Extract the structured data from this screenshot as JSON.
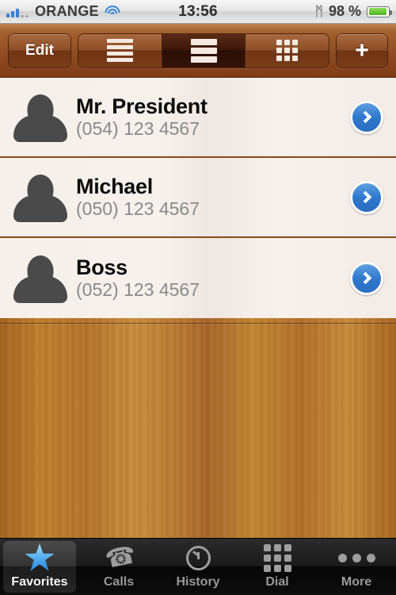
{
  "status_bar": {
    "signal_icon": "signal-bars-icon",
    "signal_bars_filled": 3,
    "signal_bars_total": 5,
    "carrier": "ORANGE",
    "wifi_icon": "wifi-icon",
    "time": "13:56",
    "bluetooth_icon": "bluetooth-icon",
    "bluetooth_glyph": "ᛗ",
    "battery_percent": "98 %",
    "battery_level": 98,
    "battery_icon": "battery-icon",
    "battery_color": "#6ec62e"
  },
  "toolbar": {
    "edit_label": "Edit",
    "add_label": "+",
    "segments": [
      {
        "name": "list-compact-view",
        "icon": "list-lines-icon",
        "selected": false
      },
      {
        "name": "list-large-view",
        "icon": "list-thick-lines-icon",
        "selected": true
      },
      {
        "name": "grid-view",
        "icon": "grid-icon",
        "selected": false
      }
    ],
    "background_color": "#8e4a21"
  },
  "contacts": [
    {
      "name": "Mr. President",
      "phone": "(054) 123 4567",
      "avatar_icon": "person-silhouette-icon",
      "disclosure_icon": "chevron-right-icon"
    },
    {
      "name": "Michael",
      "phone": "(050) 123 4567",
      "avatar_icon": "person-silhouette-icon",
      "disclosure_icon": "chevron-right-icon"
    },
    {
      "name": "Boss",
      "phone": "(052) 123 4567",
      "avatar_icon": "person-silhouette-icon",
      "disclosure_icon": "chevron-right-icon"
    }
  ],
  "tab_bar": {
    "accent_color": "#3f9ee8",
    "tabs": [
      {
        "label": "Favorites",
        "icon": "star-icon",
        "selected": true
      },
      {
        "label": "Calls",
        "icon": "phone-handset-icon",
        "selected": false
      },
      {
        "label": "History",
        "icon": "clock-icon",
        "selected": false
      },
      {
        "label": "Dial",
        "icon": "keypad-icon",
        "selected": false
      },
      {
        "label": "More",
        "icon": "ellipsis-icon",
        "selected": false
      }
    ]
  }
}
